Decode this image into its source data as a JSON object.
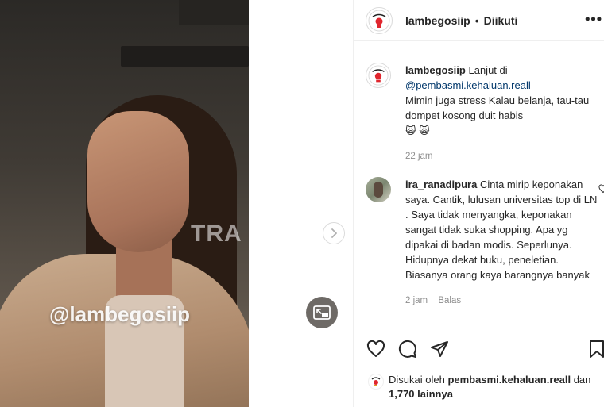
{
  "media": {
    "watermark": "@lambegosiip",
    "background_watermark": "TRA"
  },
  "header": {
    "username": "lambegosiip",
    "separator": "•",
    "follow_status": "Diikuti",
    "more": "•••"
  },
  "caption": {
    "username": "lambegosiip",
    "text_before_mention": "Lanjut di",
    "mention": "@pembasmi.kehaluan.reall",
    "text": "Mimin juga stress Kalau belanja, tau-tau dompet kosong duit habis",
    "emojis": "🙀 🙀",
    "time": "22 jam"
  },
  "comment": {
    "username": "ira_ranadipura",
    "text": "Cinta mirip keponakan saya. Cantik, lulusan universitas top di LN . Saya tidak menyangka, keponakan sangat tidak suka shopping. Apa yg dipakai di badan modis. Seperlunya. Hidupnya dekat buku, peneletian. Biasanya orang kaya barangnya banyak",
    "time": "2 jam",
    "reply": "Balas"
  },
  "likes": {
    "prefix": "Disukai oleh",
    "user": "pembasmi.kehaluan.reall",
    "connector": "dan",
    "count": "1,770 lainnya"
  },
  "icons": {
    "like": "heart-icon",
    "comment": "comment-icon",
    "share": "share-icon",
    "save": "bookmark-icon",
    "next": "chevron-right-icon",
    "pip": "picture-in-picture-icon"
  }
}
